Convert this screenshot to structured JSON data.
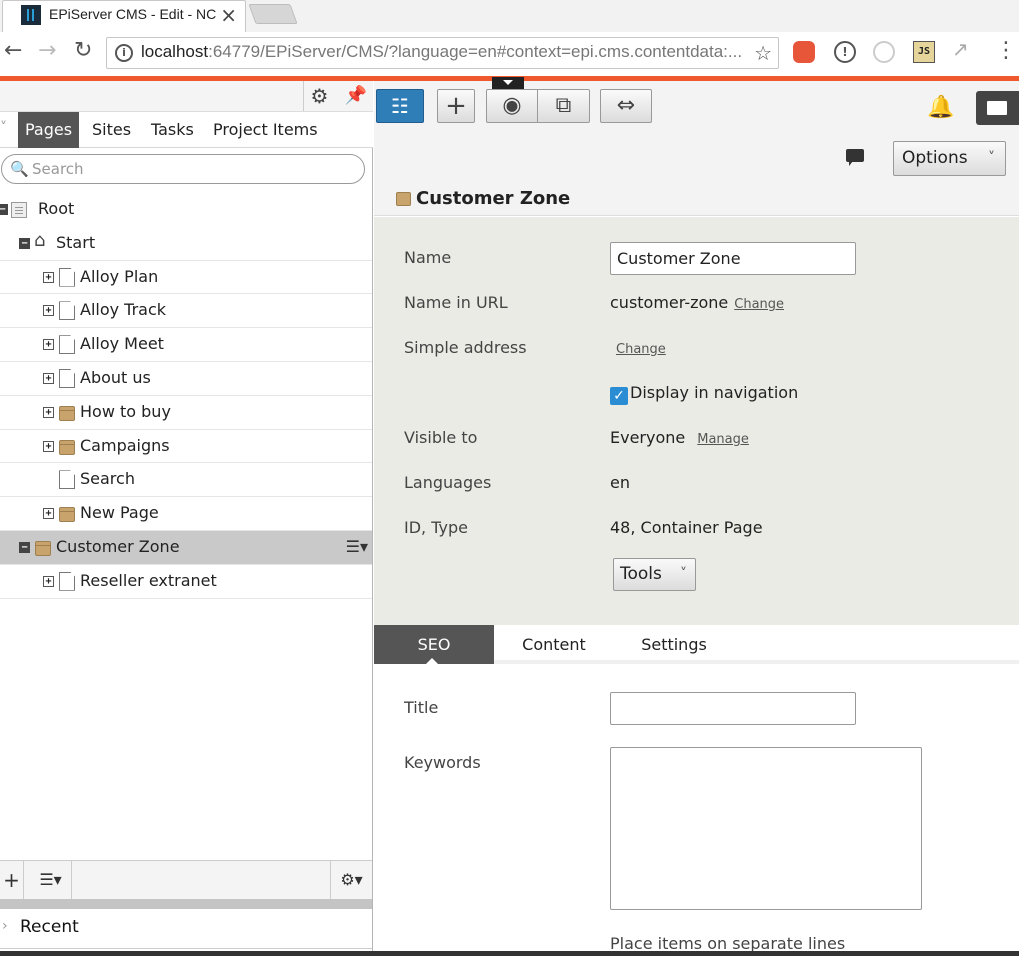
{
  "browser": {
    "tab_title": "EPiServer CMS - Edit - NC",
    "tab_close": "×",
    "url_host": "localhost",
    "url_rest": ":64779/EPiServer/CMS/?language=en#context=epi.cms.contentdata:...",
    "back": "←",
    "forward": "→",
    "reload": "↻",
    "info_icon": "i",
    "star": "☆",
    "ext2": "!",
    "ext4": "JS",
    "ext5": "↗",
    "menu": "⋮"
  },
  "left_pane": {
    "gear": "⚙",
    "pin": "📌",
    "tabs_chevron": "˅",
    "tabs": [
      {
        "label": "Pages",
        "active": true
      },
      {
        "label": "Sites",
        "active": false
      },
      {
        "label": "Tasks",
        "active": false
      },
      {
        "label": "Project Items",
        "active": false
      }
    ],
    "search_icon": "🔍",
    "search_placeholder": "Search",
    "tree": [
      {
        "label": "Root",
        "toggle": "−",
        "icon": "root"
      },
      {
        "label": "Start",
        "toggle": "−",
        "icon": "home"
      },
      {
        "label": "Alloy Plan",
        "toggle": "+",
        "icon": "page"
      },
      {
        "label": "Alloy Track",
        "toggle": "+",
        "icon": "page"
      },
      {
        "label": "Alloy Meet",
        "toggle": "+",
        "icon": "page"
      },
      {
        "label": "About us",
        "toggle": "+",
        "icon": "page"
      },
      {
        "label": "How to buy",
        "toggle": "+",
        "icon": "folder"
      },
      {
        "label": "Campaigns",
        "toggle": "+",
        "icon": "folder"
      },
      {
        "label": "Search",
        "toggle": "",
        "icon": "page"
      },
      {
        "label": "New Page",
        "toggle": "+",
        "icon": "folder"
      },
      {
        "label": "Customer Zone",
        "toggle": "−",
        "icon": "folder",
        "selected": true
      },
      {
        "label": "Reseller extranet",
        "toggle": "+",
        "icon": "page"
      }
    ],
    "context_menu": "☰▾",
    "bottom": {
      "add": "+",
      "list": "☰▾",
      "settings": "⚙▾"
    },
    "recent_chevron": "›",
    "recent_label": "Recent"
  },
  "right_pane": {
    "toolbar": {
      "tree": "☷",
      "add": "+",
      "view": "◉",
      "preview": "⧉",
      "compare": "⇔",
      "bell": "🔔"
    },
    "options_label": "Options",
    "options_chevron": "˅",
    "page_title": "Customer Zone",
    "properties": {
      "name_label": "Name",
      "name_value": "Customer Zone",
      "url_label": "Name in URL",
      "url_value": "customer-zone",
      "url_link": "Change",
      "simple_label": "Simple address",
      "simple_link": "Change",
      "nav_check": "✓",
      "nav_label": "Display in navigation",
      "visible_label": "Visible to",
      "visible_value": "Everyone",
      "visible_link": "Manage",
      "languages_label": "Languages",
      "languages_value": "en",
      "id_label": "ID, Type",
      "id_value": "48, Container Page",
      "tools_label": "Tools",
      "tools_chevron": "˅"
    },
    "tabs": [
      {
        "label": "SEO",
        "active": true
      },
      {
        "label": "Content",
        "active": false
      },
      {
        "label": "Settings",
        "active": false
      }
    ],
    "seo": {
      "title_label": "Title",
      "title_value": "",
      "keywords_label": "Keywords",
      "keywords_value": "",
      "hint": "Place items on separate lines"
    }
  }
}
